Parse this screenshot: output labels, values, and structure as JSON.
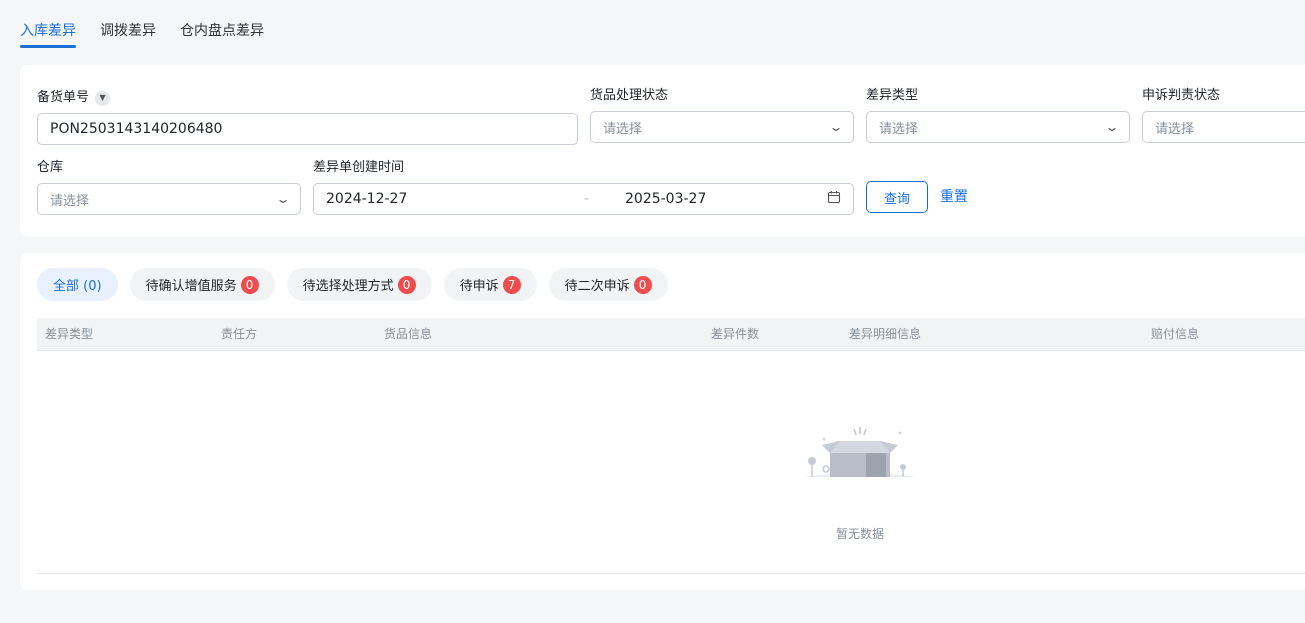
{
  "tabs": [
    "入库差异",
    "调拨差异",
    "仓内盘点差异"
  ],
  "filters": {
    "order_no": {
      "label": "备货单号",
      "value": "PON2503143140206480"
    },
    "goods_status": {
      "label": "货品处理状态",
      "placeholder": "请选择"
    },
    "diff_type": {
      "label": "差异类型",
      "placeholder": "请选择"
    },
    "appeal_status": {
      "label": "申诉判责状态",
      "placeholder": "请选择"
    },
    "warehouse": {
      "label": "仓库",
      "placeholder": "请选择"
    },
    "created_time": {
      "label": "差异单创建时间",
      "start": "2024-12-27",
      "separator": "-",
      "end": "2025-03-27"
    },
    "query_label": "查询",
    "reset_label": "重置"
  },
  "status_tabs": [
    {
      "label": "全部 (0)",
      "badge": null
    },
    {
      "label": "待确认增值服务",
      "badge": "0"
    },
    {
      "label": "待选择处理方式",
      "badge": "0"
    },
    {
      "label": "待申诉",
      "badge": "7"
    },
    {
      "label": "待二次申诉",
      "badge": "0"
    }
  ],
  "table": {
    "headers": [
      "差异类型",
      "责任方",
      "货品信息",
      "差异件数",
      "差异明细信息",
      "赔付信息"
    ],
    "rows": [],
    "empty_text": "暂无数据"
  },
  "colors": {
    "accent": "#1a6fd6",
    "badge": "#ef4d4d"
  },
  "icons": {
    "dropdown": "chevron-down-icon",
    "calendar": "calendar-icon",
    "empty": "empty-box-icon"
  }
}
